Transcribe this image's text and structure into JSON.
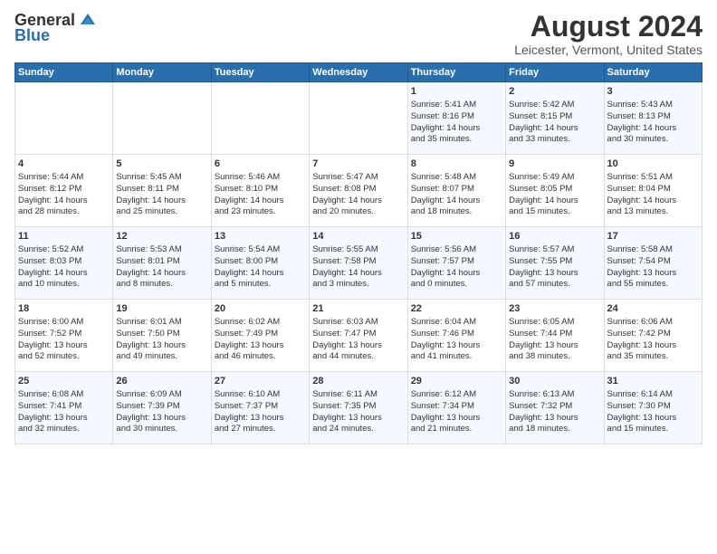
{
  "header": {
    "logo_general": "General",
    "logo_blue": "Blue",
    "title": "August 2024",
    "subtitle": "Leicester, Vermont, United States"
  },
  "days_of_week": [
    "Sunday",
    "Monday",
    "Tuesday",
    "Wednesday",
    "Thursday",
    "Friday",
    "Saturday"
  ],
  "weeks": [
    [
      {
        "day": "",
        "content": ""
      },
      {
        "day": "",
        "content": ""
      },
      {
        "day": "",
        "content": ""
      },
      {
        "day": "",
        "content": ""
      },
      {
        "day": "1",
        "content": "Sunrise: 5:41 AM\nSunset: 8:16 PM\nDaylight: 14 hours\nand 35 minutes."
      },
      {
        "day": "2",
        "content": "Sunrise: 5:42 AM\nSunset: 8:15 PM\nDaylight: 14 hours\nand 33 minutes."
      },
      {
        "day": "3",
        "content": "Sunrise: 5:43 AM\nSunset: 8:13 PM\nDaylight: 14 hours\nand 30 minutes."
      }
    ],
    [
      {
        "day": "4",
        "content": "Sunrise: 5:44 AM\nSunset: 8:12 PM\nDaylight: 14 hours\nand 28 minutes."
      },
      {
        "day": "5",
        "content": "Sunrise: 5:45 AM\nSunset: 8:11 PM\nDaylight: 14 hours\nand 25 minutes."
      },
      {
        "day": "6",
        "content": "Sunrise: 5:46 AM\nSunset: 8:10 PM\nDaylight: 14 hours\nand 23 minutes."
      },
      {
        "day": "7",
        "content": "Sunrise: 5:47 AM\nSunset: 8:08 PM\nDaylight: 14 hours\nand 20 minutes."
      },
      {
        "day": "8",
        "content": "Sunrise: 5:48 AM\nSunset: 8:07 PM\nDaylight: 14 hours\nand 18 minutes."
      },
      {
        "day": "9",
        "content": "Sunrise: 5:49 AM\nSunset: 8:05 PM\nDaylight: 14 hours\nand 15 minutes."
      },
      {
        "day": "10",
        "content": "Sunrise: 5:51 AM\nSunset: 8:04 PM\nDaylight: 14 hours\nand 13 minutes."
      }
    ],
    [
      {
        "day": "11",
        "content": "Sunrise: 5:52 AM\nSunset: 8:03 PM\nDaylight: 14 hours\nand 10 minutes."
      },
      {
        "day": "12",
        "content": "Sunrise: 5:53 AM\nSunset: 8:01 PM\nDaylight: 14 hours\nand 8 minutes."
      },
      {
        "day": "13",
        "content": "Sunrise: 5:54 AM\nSunset: 8:00 PM\nDaylight: 14 hours\nand 5 minutes."
      },
      {
        "day": "14",
        "content": "Sunrise: 5:55 AM\nSunset: 7:58 PM\nDaylight: 14 hours\nand 3 minutes."
      },
      {
        "day": "15",
        "content": "Sunrise: 5:56 AM\nSunset: 7:57 PM\nDaylight: 14 hours\nand 0 minutes."
      },
      {
        "day": "16",
        "content": "Sunrise: 5:57 AM\nSunset: 7:55 PM\nDaylight: 13 hours\nand 57 minutes."
      },
      {
        "day": "17",
        "content": "Sunrise: 5:58 AM\nSunset: 7:54 PM\nDaylight: 13 hours\nand 55 minutes."
      }
    ],
    [
      {
        "day": "18",
        "content": "Sunrise: 6:00 AM\nSunset: 7:52 PM\nDaylight: 13 hours\nand 52 minutes."
      },
      {
        "day": "19",
        "content": "Sunrise: 6:01 AM\nSunset: 7:50 PM\nDaylight: 13 hours\nand 49 minutes."
      },
      {
        "day": "20",
        "content": "Sunrise: 6:02 AM\nSunset: 7:49 PM\nDaylight: 13 hours\nand 46 minutes."
      },
      {
        "day": "21",
        "content": "Sunrise: 6:03 AM\nSunset: 7:47 PM\nDaylight: 13 hours\nand 44 minutes."
      },
      {
        "day": "22",
        "content": "Sunrise: 6:04 AM\nSunset: 7:46 PM\nDaylight: 13 hours\nand 41 minutes."
      },
      {
        "day": "23",
        "content": "Sunrise: 6:05 AM\nSunset: 7:44 PM\nDaylight: 13 hours\nand 38 minutes."
      },
      {
        "day": "24",
        "content": "Sunrise: 6:06 AM\nSunset: 7:42 PM\nDaylight: 13 hours\nand 35 minutes."
      }
    ],
    [
      {
        "day": "25",
        "content": "Sunrise: 6:08 AM\nSunset: 7:41 PM\nDaylight: 13 hours\nand 32 minutes."
      },
      {
        "day": "26",
        "content": "Sunrise: 6:09 AM\nSunset: 7:39 PM\nDaylight: 13 hours\nand 30 minutes."
      },
      {
        "day": "27",
        "content": "Sunrise: 6:10 AM\nSunset: 7:37 PM\nDaylight: 13 hours\nand 27 minutes."
      },
      {
        "day": "28",
        "content": "Sunrise: 6:11 AM\nSunset: 7:35 PM\nDaylight: 13 hours\nand 24 minutes."
      },
      {
        "day": "29",
        "content": "Sunrise: 6:12 AM\nSunset: 7:34 PM\nDaylight: 13 hours\nand 21 minutes."
      },
      {
        "day": "30",
        "content": "Sunrise: 6:13 AM\nSunset: 7:32 PM\nDaylight: 13 hours\nand 18 minutes."
      },
      {
        "day": "31",
        "content": "Sunrise: 6:14 AM\nSunset: 7:30 PM\nDaylight: 13 hours\nand 15 minutes."
      }
    ]
  ]
}
